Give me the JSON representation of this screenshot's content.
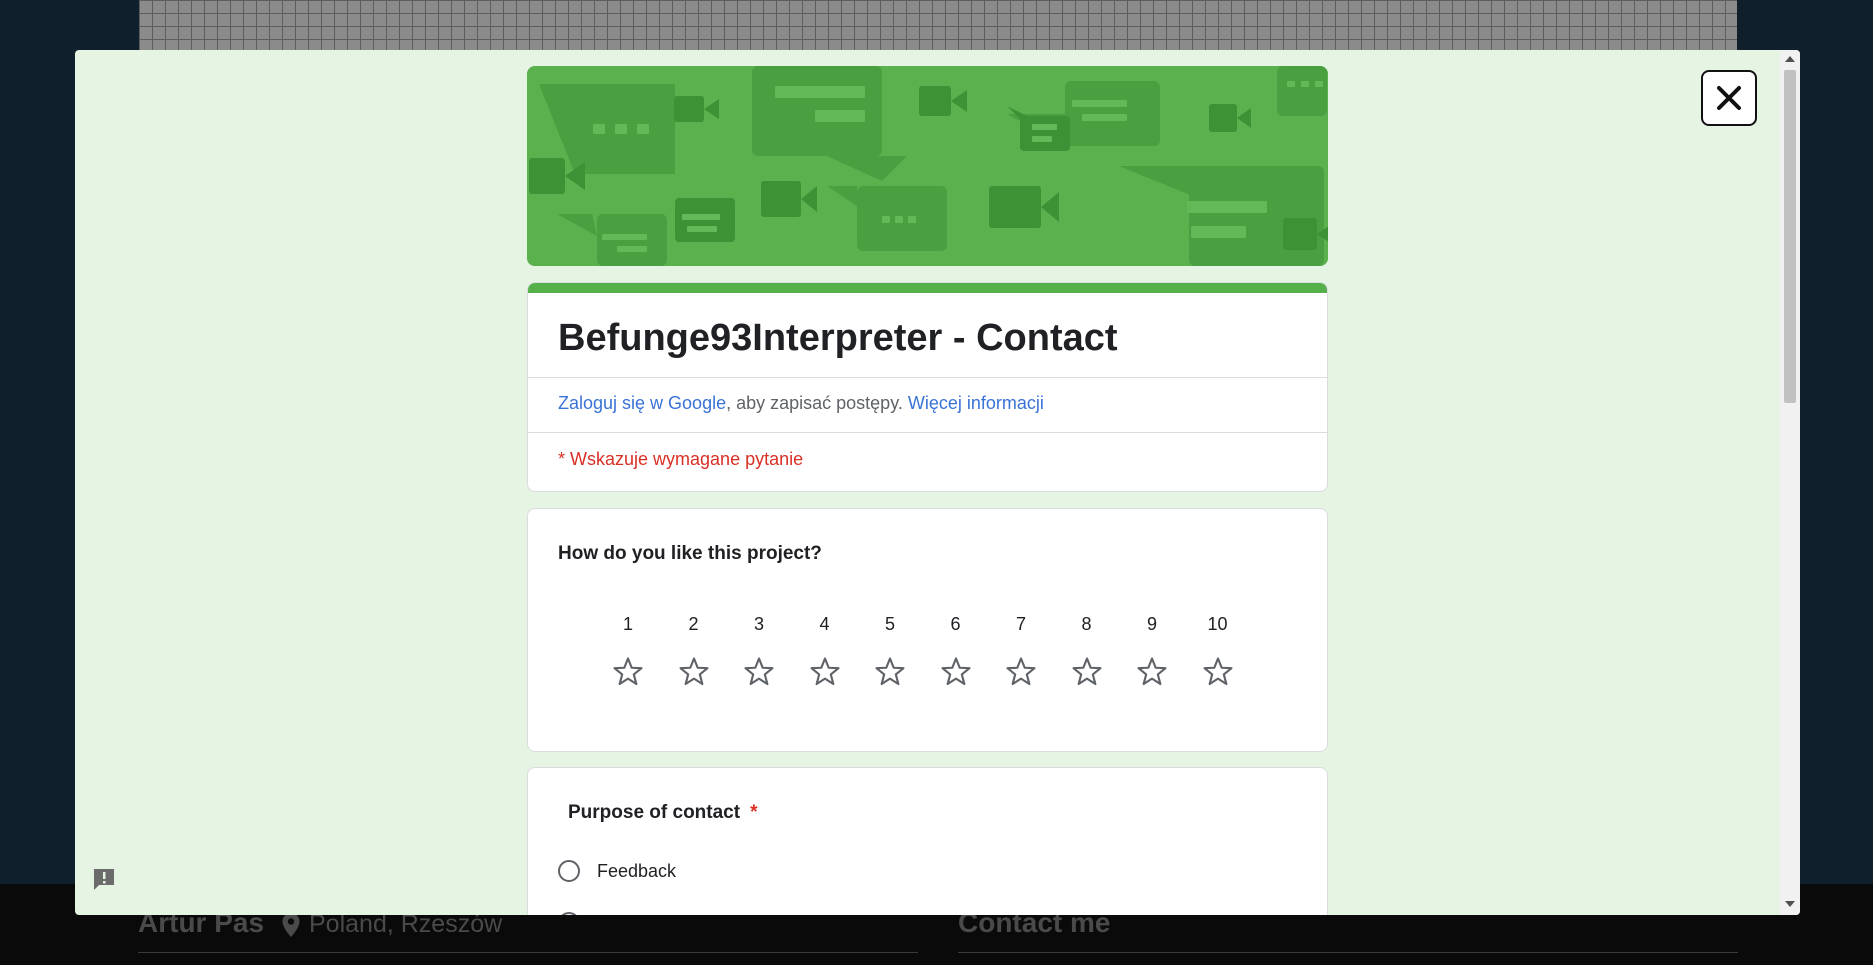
{
  "background": {
    "name": "Artur Pas",
    "location": "Poland, Rzeszów",
    "contact_heading": "Contact me"
  },
  "modal": {
    "close_icon": "close-x-icon",
    "report_icon": "report-problem-icon"
  },
  "form": {
    "title": "Befunge93Interpreter - Contact",
    "signin_link": "Zaloguj się w Google",
    "signin_text": ", aby zapisać postępy.",
    "more_info_link": "Więcej informacji",
    "required_note": "* Wskazuje wymagane pytanie",
    "accent_color": "#56b04a",
    "questions": [
      {
        "title": "How do you like this project?",
        "type": "rating",
        "scale": [
          "1",
          "2",
          "3",
          "4",
          "5",
          "6",
          "7",
          "8",
          "9",
          "10"
        ],
        "selected": 0
      },
      {
        "title": "Purpose of contact",
        "required_mark": "*",
        "type": "radio",
        "options": [
          "Feedback"
        ]
      }
    ]
  }
}
